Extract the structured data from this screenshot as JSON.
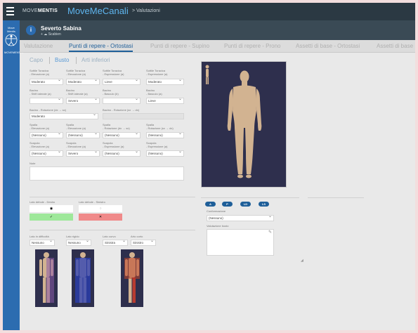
{
  "topbar": {
    "brand_prefix": "MOVE",
    "brand_suffix": "MENTIS",
    "app_title": "MoveMeCanali",
    "breadcrumb": "> Valutazioni"
  },
  "sidebar": {
    "logo_top": "Move Mentis",
    "logo_bottom": "MOVEMENTIS"
  },
  "patient": {
    "badge": "i",
    "name": "Severto Sabina",
    "sub": "+ ☁ Scabien"
  },
  "tabs": [
    {
      "label": "Valutazione",
      "active": false
    },
    {
      "label": "Punti di repere - Ortostasi",
      "active": true
    },
    {
      "label": "Punti di repere - Supino",
      "active": false
    },
    {
      "label": "Punti di repere - Prono",
      "active": false
    },
    {
      "label": "Assetti di base - Ortostasi",
      "active": false
    },
    {
      "label": "Assetti di base",
      "active": false
    }
  ],
  "subtabs": [
    "Capo",
    "Busto",
    "Arti inferiori"
  ],
  "form": {
    "row1": [
      {
        "label1": "Sottile Toracica",
        "label2": "- Elevazione (a)",
        "value": "Moderato"
      },
      {
        "label1": "Sottile Toracica",
        "label2": "- Elevazione (a)",
        "value": "Moderato"
      },
      {
        "label1": "Sottile Toracica",
        "label2": "- Espressione (a)",
        "value": "Lieve"
      },
      {
        "label1": "Sottile Toracica",
        "label2": "- Espressione (a)",
        "value": "Moderato"
      }
    ],
    "row2": [
      {
        "label1": "Bacino",
        "label2": "- Shift laterale (a)",
        "value": ""
      },
      {
        "label1": "Bacino",
        "label2": "- Shift laterale (a)",
        "value": "Severo"
      },
      {
        "label1": "Bacino",
        "label2": "- Basculo (b)",
        "value": ""
      },
      {
        "label1": "Bacino",
        "label2": "- Basculo (a)",
        "value": "Lieve"
      }
    ],
    "rot_left_label": "Bacino - Rotazione (dx → sx)",
    "rot_left_value": "Moderato",
    "rot_right_label": "Bacino - Rotazione (sx → dx)",
    "rot_right_value": "",
    "row3": [
      {
        "label1": "Spalla",
        "label2": "- Elevazione (a)",
        "value": "(Nessuno)"
      },
      {
        "label1": "Spalla",
        "label2": "- Elevazione (a)",
        "value": "(Nessuno)"
      },
      {
        "label1": "Spalla",
        "label2": "- Rotazione (dx → sx)",
        "value": "(Nessuno)"
      },
      {
        "label1": "Spalla",
        "label2": "- Rotazione (sx → dx)",
        "value": "(Nessuno)"
      }
    ],
    "row4": [
      {
        "label1": "Scapola",
        "label2": "- Elevazione (a)",
        "value": "(Nessuno)"
      },
      {
        "label1": "Scapola",
        "label2": "- Elevazione (a)",
        "value": "Severo"
      },
      {
        "label1": "Scapola",
        "label2": "- Espressione (a)",
        "value": "(Nessuno)"
      },
      {
        "label1": "Scapola",
        "label2": "- Espressione (a)",
        "value": "(Nessuno)"
      }
    ],
    "note_label": "Note"
  },
  "lato": {
    "left_label": "Lato debole - Destro",
    "right_label": "Lato debole - Sinistro",
    "left_top": "◉",
    "left_bottom": "✓",
    "right_top": "○",
    "right_bottom": "✕",
    "green": "#9ee89a",
    "red": "#f08a8a"
  },
  "lower": [
    {
      "label": "Lato in difficoltà",
      "value": "Nessuno",
      "tint": "#8a5aa8"
    },
    {
      "label": "Lato rigido",
      "value": "Nessuno",
      "tint": "#2a3fb5"
    },
    {
      "label": "Lato curvo",
      "value": "Sinistra",
      "tint": "#c0452a"
    },
    {
      "label": "Arto corto",
      "value": "Sinistro",
      "tint": ""
    }
  ],
  "view_buttons": [
    "A",
    "P",
    "LD",
    "LS"
  ],
  "conformation": {
    "label": "Conformazione",
    "value": "(Nessuno)",
    "note_label": "Valutazione busto"
  },
  "colors": {
    "accent": "#1f5f99",
    "topbar": "#2b3943",
    "sidebar": "#2c6cb0",
    "silhouette_bg": "#2e2f4d",
    "skin": "#d2b391"
  }
}
